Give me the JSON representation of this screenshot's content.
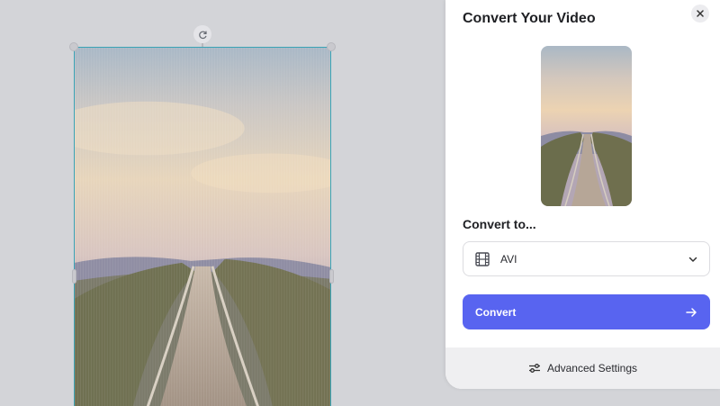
{
  "panel": {
    "title": "Convert Your Video",
    "convert_to_label": "Convert to...",
    "format_select": {
      "value": "AVI",
      "icon": "film-icon"
    },
    "convert_button": {
      "label": "Convert",
      "icon": "arrow-right-icon"
    },
    "advanced_settings": {
      "label": "Advanced Settings",
      "icon": "sliders-icon"
    },
    "close_icon": "close-icon"
  },
  "canvas": {
    "rotate_icon": "rotate-icon",
    "image": "mountain-path-landscape"
  },
  "colors": {
    "accent": "#5864f0",
    "selection_border": "#3aa3b5",
    "background": "#d3d4d8"
  }
}
